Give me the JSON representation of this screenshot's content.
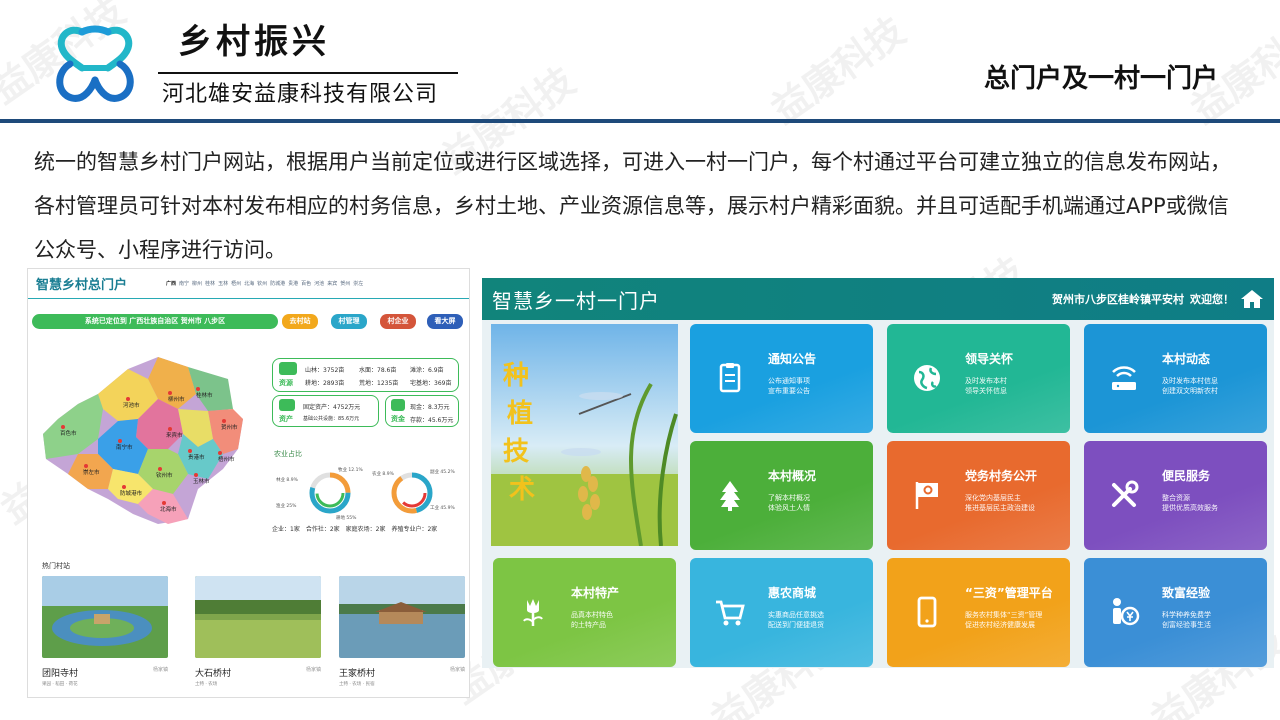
{
  "header": {
    "brand_title": "乡村振兴",
    "company": "河北雄安益康科技有限公司",
    "page_title": "总门户及一村一门户",
    "watermark": "益康科技"
  },
  "intro": "统一的智慧乡村门户网站，根据用户当前定位或进行区域选择，可进入一村一门户，每个村通过平台可建立独立的信息发布网站，各村管理员可针对本村发布相应的村务信息，乡村土地、产业资源信息等，展示村户精彩面貌。并且可适配手机端通过APP或微信公众号、小程序进行访问。",
  "left_portal": {
    "title": "智慧乡村总门户",
    "nav": [
      "广西",
      "南宁",
      "柳州",
      "桂林",
      "玉林",
      "梧州",
      "北海",
      "钦州",
      "防城港",
      "贵港",
      "百色",
      "河池",
      "来宾",
      "贺州",
      "崇左"
    ],
    "location_bar": "系统已定位到 广西壮族自治区 贺州市 八步区",
    "buttons": [
      "去村站",
      "村管理",
      "村企业",
      "看大屏"
    ],
    "map_labels": [
      "桂林市",
      "柳州市",
      "河池市",
      "来宾市",
      "贺州市",
      "梧州市",
      "百色市",
      "南宁市",
      "贵港市",
      "崇左市",
      "玉林市",
      "钦州市",
      "防城港市",
      "北海市"
    ],
    "resource_card": {
      "label": "资源",
      "rows": [
        "山林：3752亩",
        "水面：78.6亩",
        "滩涂：6.9亩",
        "耕地：2893亩",
        "荒地：1235亩",
        "宅基地：369亩"
      ]
    },
    "asset_card": {
      "label": "资产",
      "rows": [
        "固定资产：4752万元",
        "基础公共设施：85.6万元"
      ]
    },
    "fund_card": {
      "label": "资金",
      "rows": [
        "现金：8.3万元",
        "存款：45.6万元"
      ]
    },
    "agri_title": "农业占比",
    "donut1": {
      "labels": [
        "牧业 12.1%",
        "林业 8.9%",
        "耕地 55%",
        "渔业 25%"
      ]
    },
    "donut2": {
      "labels": [
        "农业 8.9%",
        "副业 45.2%",
        "工业 45.9%"
      ]
    },
    "stats": "企业：1家　合作社：2家　家庭农场：2家　养殖专业户：2家",
    "hot_title": "热门村站",
    "villages": [
      {
        "name": "团阳寺村",
        "tag": "杨家镇",
        "meta": "果园 · 稻田 · 荷花"
      },
      {
        "name": "大石桥村",
        "tag": "杨家镇",
        "meta": "土特 · 农场"
      },
      {
        "name": "王家桥村",
        "tag": "杨家镇",
        "meta": "土特 · 农场 · 民宿"
      }
    ]
  },
  "right_portal": {
    "title": "智慧乡一村一门户",
    "location": "贺州市八步区桂岭镇平安村",
    "welcome": "欢迎您！",
    "hero_text": "种植技术",
    "tiles": [
      {
        "title": "通知公告",
        "sub1": "公布通知事项",
        "sub2": "宣布重要公告",
        "color": "#1aa0e0",
        "icon": "clipboard-icon"
      },
      {
        "title": "领导关怀",
        "sub1": "及时发布本村",
        "sub2": "领导关怀信息",
        "color": "#22b795",
        "icon": "globe-icon"
      },
      {
        "title": "本村动态",
        "sub1": "及时发布本村信息",
        "sub2": "创建双文明新农村",
        "color": "#1c95d6",
        "icon": "router-icon"
      },
      {
        "title": "本村概况",
        "sub1": "了解本村概况",
        "sub2": "体验风土人情",
        "color": "#4caf3a",
        "icon": "tree-icon"
      },
      {
        "title": "党务村务公开",
        "sub1": "深化党内基层民主",
        "sub2": "推进基层民主政治建设",
        "color": "#e86a2e",
        "icon": "flag-icon"
      },
      {
        "title": "便民服务",
        "sub1": "整合资源",
        "sub2": "提供优质高效服务",
        "color": "#7d4fbf",
        "icon": "tools-icon"
      },
      {
        "title": "本村特产",
        "sub1": "品真本村特色",
        "sub2": "的土特产品",
        "color": "#7dc544",
        "icon": "tulip-icon"
      },
      {
        "title": "惠农商城",
        "sub1": "实惠商品任意挑选",
        "sub2": "配送到门便捷退货",
        "color": "#38b5de",
        "icon": "cart-icon"
      },
      {
        "title": "“三资”管理平台",
        "sub1": "服务农村集体“三资”管理",
        "sub2": "促进农村经济健康发展",
        "color": "#f2a21a",
        "icon": "tablet-icon"
      },
      {
        "title": "致富经验",
        "sub1": "科学种养免费学",
        "sub2": "创富经验事生活",
        "color": "#3b8fd6",
        "icon": "money-icon"
      }
    ]
  }
}
